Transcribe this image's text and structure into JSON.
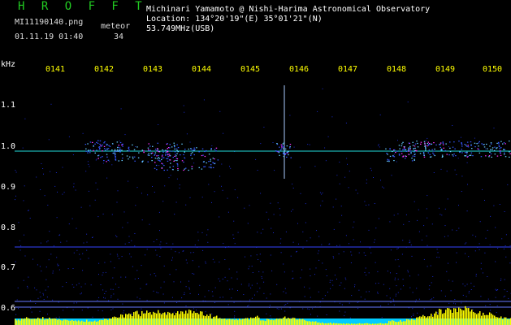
{
  "header": {
    "brand": "H R O F F T",
    "filename": "MI11190140.png",
    "datetime": "01.11.19 01:40",
    "meteor_label": "meteor",
    "meteor_count": "34",
    "observer": "Michinari Yamamoto @ Nishi-Harima Astronomical Observatory",
    "location": "Location: 134°20'19\"(E) 35°01'21\"(N)",
    "frequency": "53.749MHz(USB)"
  },
  "axes": {
    "y_unit": "kHz",
    "x_ticks": [
      "0141",
      "0142",
      "0143",
      "0144",
      "0145",
      "0146",
      "0147",
      "0148",
      "0149",
      "0150"
    ],
    "y_ticks": [
      "1.1",
      "1.0",
      "0.9",
      "0.8",
      "0.7",
      "0.6"
    ]
  },
  "colors": {
    "background": "#000000",
    "time_labels": "#ffff00",
    "brand": "#22cc22",
    "carrier_line": "#22dddd",
    "reference_line": "#3344ff",
    "echo_hot": "#ff33ff",
    "echo_mid": "#66ccff",
    "intensity_bars": "#ffff00",
    "intensity_base": "#00ccff"
  }
}
